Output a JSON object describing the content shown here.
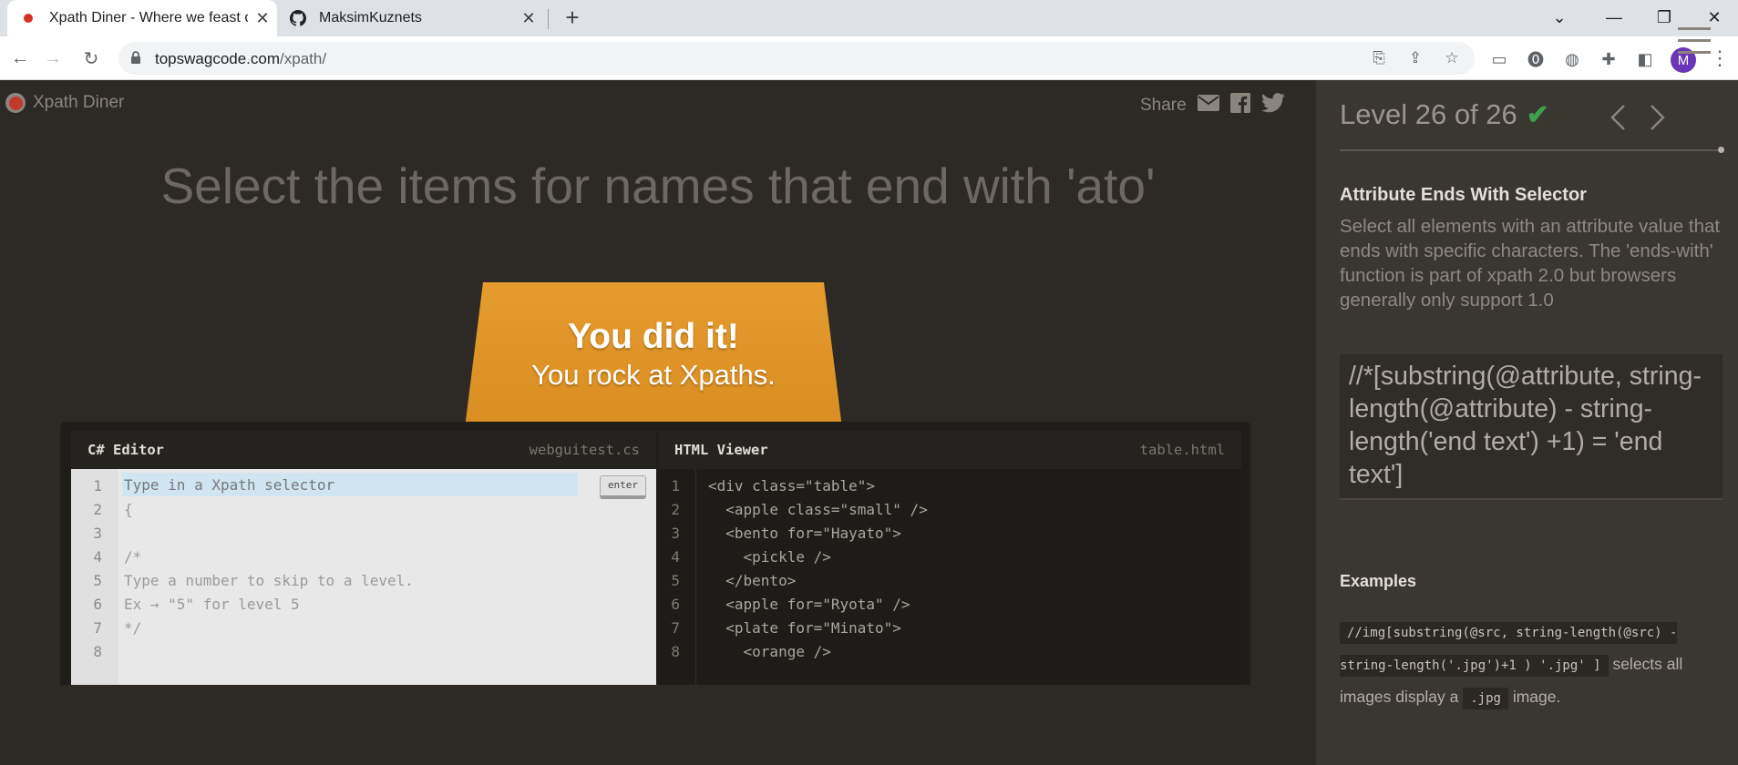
{
  "browser": {
    "tabs": [
      {
        "title": "Xpath Diner - Where we feast on",
        "icon": "red-dot-icon"
      },
      {
        "title": "MaksimKuznets",
        "icon": "github-icon"
      }
    ],
    "url_domain": "topswagcode.com",
    "url_path": "/xpath/"
  },
  "header": {
    "logo": "Xpath Diner",
    "share": "Share"
  },
  "instruction": "Select the items for names that end with 'ato'",
  "table": {
    "line1": "You did it!",
    "line2": "You rock at Xpaths."
  },
  "editor": {
    "title": "C# Editor",
    "file": "webguitest.cs",
    "placeholder": "Type in a Xpath selector",
    "enter": "enter",
    "lines": [
      "1",
      "2",
      "3",
      "4",
      "5",
      "6",
      "7",
      "8"
    ],
    "code": [
      "",
      "{",
      "",
      "/*",
      "Type a number to skip to a level.",
      "Ex → \"5\" for level 5",
      "*/",
      ""
    ]
  },
  "viewer": {
    "title": "HTML Viewer",
    "file": "table.html",
    "lines": [
      "1",
      "2",
      "3",
      "4",
      "5",
      "6",
      "7",
      "8"
    ],
    "code": [
      "<div class=\"table\">",
      "  <apple class=\"small\" />",
      "  <bento for=\"Hayato\">",
      "    <pickle />",
      "  </bento>",
      "  <apple for=\"Ryota\" />",
      "  <plate for=\"Minato\">",
      "    <orange />"
    ]
  },
  "sidebar": {
    "level": "Level 26 of 26",
    "selector_name": "Attribute Ends With Selector",
    "description": "Select all elements with an attribute value that ends with specific characters. The 'ends-with' function is part of xpath 2.0 but browsers generally only support 1.0",
    "syntax": "//*[substring(@attribute, string-length(@attribute) - string-length('end text') +1) = 'end text']",
    "examples_title": "Examples",
    "example_code": "//img[substring(@src, string-length(@src) - string-length('.jpg')+1 ) '.jpg' ]",
    "example_text1": "selects all images display a",
    "example_code2": ".jpg",
    "example_text2": "image."
  },
  "colors": {
    "accent_check": "#3ea04c",
    "table_orange": "#e0972c",
    "page_bg": "#2d2a26",
    "sidebar_bg": "#3a3731"
  },
  "profile_initial": "M"
}
